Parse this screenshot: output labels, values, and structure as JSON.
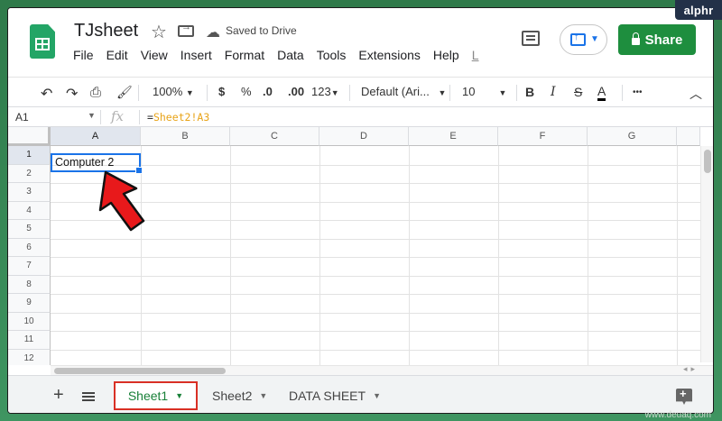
{
  "brand_badge": "alphr",
  "watermark": "www.deuaq.com",
  "document": {
    "title": "TJsheet",
    "save_status": "Saved to Drive"
  },
  "menu": [
    "File",
    "Edit",
    "View",
    "Insert",
    "Format",
    "Data",
    "Tools",
    "Extensions",
    "Help",
    "L"
  ],
  "share_label": "Share",
  "toolbar": {
    "zoom": "100%",
    "currency": "$",
    "percent": "%",
    "decrease_decimals": ".0",
    "increase_decimals": ".00",
    "more_formats": "123",
    "font": "Default (Ari...",
    "font_size": "10",
    "bold": "B",
    "italic": "I",
    "strikethrough": "S",
    "text_color": "A",
    "more": "•••"
  },
  "formula_bar": {
    "name_box": "A1",
    "fx": "fx",
    "formula_prefix": "=",
    "formula_ref": "Sheet2!A3"
  },
  "grid": {
    "columns": [
      "A",
      "B",
      "C",
      "D",
      "E",
      "F",
      "G"
    ],
    "rows": [
      "1",
      "2",
      "3",
      "4",
      "5",
      "6",
      "7",
      "8",
      "9",
      "10",
      "11",
      "12"
    ],
    "selected_cell": "A1",
    "cell_A1": "Computer 2"
  },
  "sheets": {
    "add": "+",
    "tabs": [
      {
        "label": "Sheet1",
        "active": true
      },
      {
        "label": "Sheet2",
        "active": false
      },
      {
        "label": "DATA SHEET",
        "active": false
      }
    ]
  },
  "colors": {
    "share_green": "#1e8e3e",
    "selection_blue": "#1a73e8",
    "formula_ref": "#e8a317",
    "annotation_red": "#e8191b",
    "active_tab_border": "#d93025"
  }
}
